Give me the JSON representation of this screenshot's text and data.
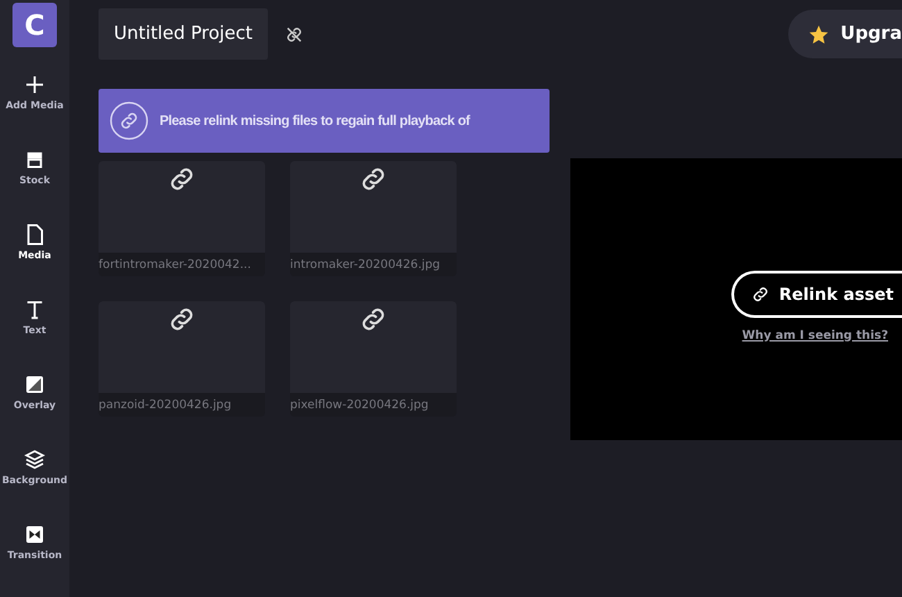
{
  "logo": "C",
  "sidebar": {
    "items": [
      {
        "kind": "plus",
        "label": "Add Media",
        "selected": false
      },
      {
        "kind": "stock",
        "label": "Stock",
        "selected": false
      },
      {
        "kind": "file",
        "label": "Media",
        "selected": true
      },
      {
        "kind": "text",
        "label": "Text",
        "selected": false
      },
      {
        "kind": "overlay",
        "label": "Overlay",
        "selected": false
      },
      {
        "kind": "layers",
        "label": "Background",
        "selected": false
      },
      {
        "kind": "transition",
        "label": "Transition",
        "selected": false
      }
    ]
  },
  "header": {
    "project_title": "Untitled Project",
    "upgrade_button": "Upgra"
  },
  "banner": {
    "text": "Please relink missing files to regain full playback of"
  },
  "media": [
    {
      "name": "fortintromaker-2020042..."
    },
    {
      "name": "intromaker-20200426.jpg"
    },
    {
      "name": "panzoid-20200426.jpg"
    },
    {
      "name": "pixelflow-20200426.jpg"
    }
  ],
  "preview": {
    "relink_button": "Relink asset",
    "help_link": "Why am I seeing this?"
  }
}
